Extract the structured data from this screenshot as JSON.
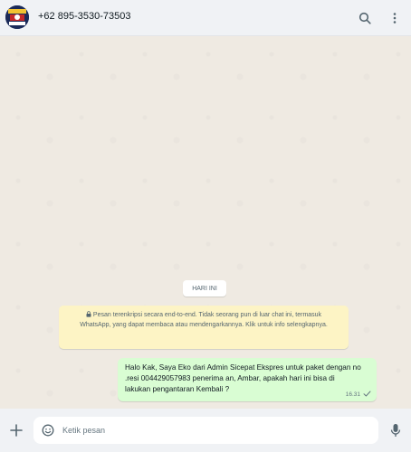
{
  "header": {
    "contact_name": "+62 895-3530-73503",
    "avatar_icon": "avatar-image",
    "search_icon": "search-icon",
    "menu_icon": "kebab-menu-icon"
  },
  "chat": {
    "date_label": "HARI INI",
    "encryption_notice": {
      "icon": "lock-icon",
      "text": "Pesan terenkripsi secara end-to-end. Tidak seorang pun di luar chat ini, termasuk WhatsApp, yang dapat membaca atau mendengarkannya. Klik untuk info selengkapnya."
    },
    "messages": [
      {
        "text": "Halo Kak, Saya Eko  dari Admin Sicepat Ekspres untuk paket dengan no .resi 004429057983 penerima an, Ambar, apakah hari ini bisa di lakukan pengantaran Kembali ?",
        "time": "16.31",
        "status_icon": "single-check-icon",
        "outgoing": true
      }
    ]
  },
  "composer": {
    "placeholder": "Ketik pesan",
    "value": "",
    "attach_icon": "plus-icon",
    "emoji_icon": "emoji-icon",
    "mic_icon": "microphone-icon"
  },
  "colors": {
    "header_bg": "#f0f2f5",
    "chat_bg": "#efeae2",
    "outgoing_bubble": "#d9fdd3",
    "system_notice": "#fdf4c5",
    "check": "#667781"
  }
}
